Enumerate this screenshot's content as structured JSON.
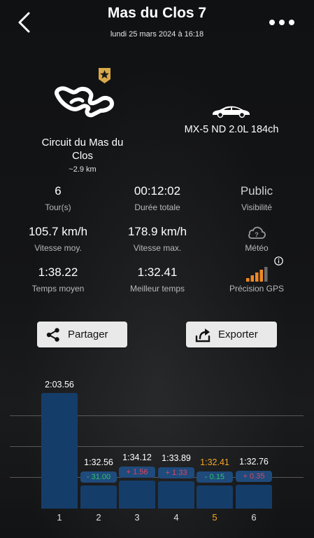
{
  "header": {
    "title": "Mas du Clos 7",
    "date": "lundi 25 mars 2024 à 16:18"
  },
  "circuit": {
    "name": "Circuit du Mas du Clos",
    "length": "~2.9 km"
  },
  "car": {
    "name": "MX-5 ND 2.0L 184ch"
  },
  "stats": {
    "laps": {
      "value": "6",
      "label": "Tour(s)"
    },
    "duration": {
      "value": "00:12:02",
      "label": "Durée totale"
    },
    "visibility": {
      "value": "Public",
      "label": "Visibilité"
    },
    "avg_speed": {
      "value": "105.7 km/h",
      "label": "Vitesse moy."
    },
    "max_speed": {
      "value": "178.9 km/h",
      "label": "Vitesse max."
    },
    "weather": {
      "label": "Météo",
      "icon": "cloud-question-icon"
    },
    "avg_time": {
      "value": "1:38.22",
      "label": "Temps moyen"
    },
    "best_time": {
      "value": "1:32.41",
      "label": "Meilleur temps"
    },
    "gps": {
      "label": "Précision GPS",
      "icon": "signal-bars-icon",
      "level": 4,
      "max_level": 5
    }
  },
  "actions": {
    "share_label": "Partager",
    "export_label": "Exporter"
  },
  "colors": {
    "bar": "#153d6a",
    "best": "#f5a623",
    "delta_good": "#2fc56a",
    "delta_bad": "#e0455b",
    "delta_bg": "#1f4a7c"
  },
  "chart_data": {
    "type": "bar",
    "categories": [
      "1",
      "2",
      "3",
      "4",
      "5",
      "6"
    ],
    "lap_times": [
      "2:03.56",
      "1:32.56",
      "1:34.12",
      "1:33.89",
      "1:32.41",
      "1:32.76"
    ],
    "values": [
      123.56,
      92.56,
      94.12,
      93.89,
      92.41,
      92.76
    ],
    "deltas": [
      "",
      "- 31.00",
      "+ 1.56",
      "+ 1.33",
      "- 0.15",
      "+ 0.35"
    ],
    "delta_types": [
      "",
      "good",
      "bad",
      "bad",
      "good",
      "bad"
    ],
    "best_index": 4,
    "grid": true
  }
}
